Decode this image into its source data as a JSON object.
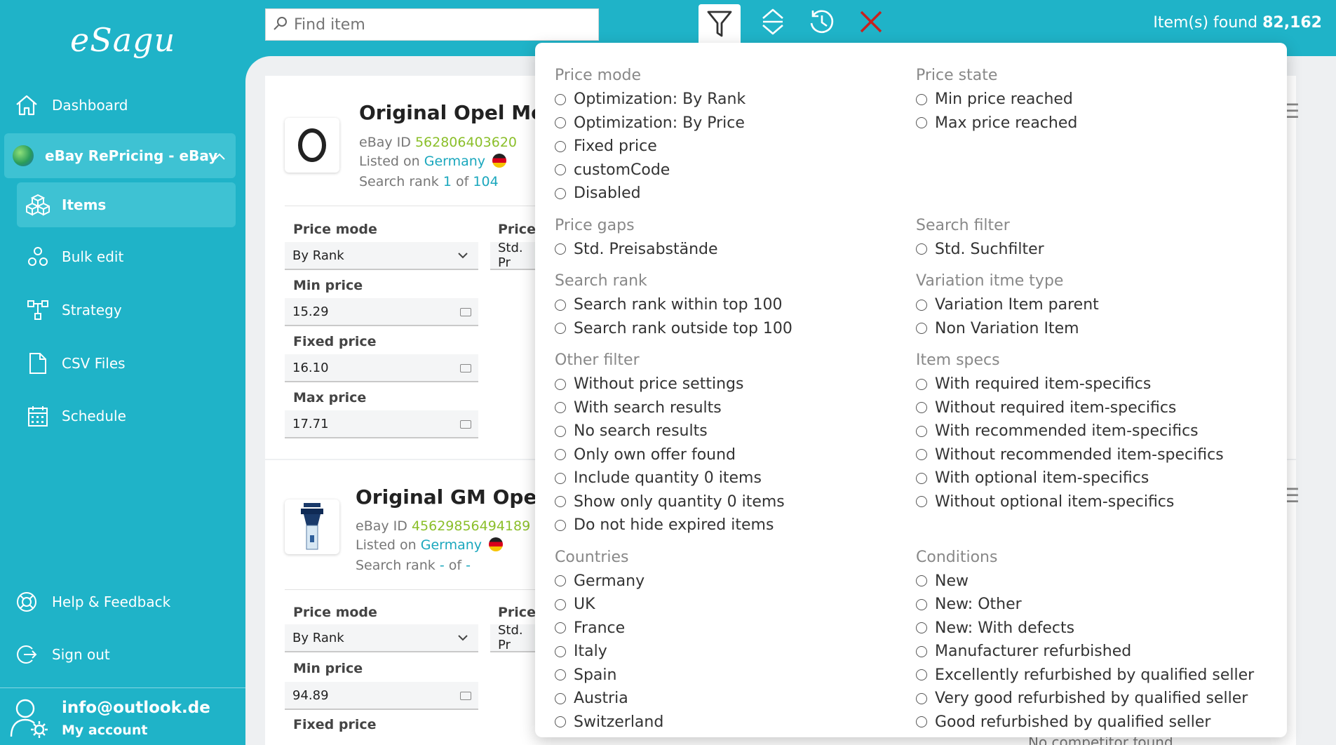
{
  "sidebar": {
    "logo": "eSagu",
    "dashboard": "Dashboard",
    "group_label": "eBay RePricing - eBay",
    "items": [
      {
        "label": "Items",
        "icon": "cubes-icon"
      },
      {
        "label": "Bulk edit",
        "icon": "bulk-edit-icon"
      },
      {
        "label": "Strategy",
        "icon": "strategy-icon"
      },
      {
        "label": "CSV Files",
        "icon": "file-icon"
      },
      {
        "label": "Schedule",
        "icon": "calendar-icon"
      }
    ],
    "help": "Help & Feedback",
    "signout": "Sign out",
    "account_email": "info@outlook.de",
    "account_label": "My account"
  },
  "topbar": {
    "search_placeholder": "Find item",
    "found_label": "Item(s) found",
    "found_count": "82,162"
  },
  "cards": [
    {
      "title": "Original Opel  Mokka",
      "ebay_id_label": "eBay ID",
      "ebay_id": "562806403620",
      "listed_label": "Listed on",
      "country": "Germany",
      "rank_label": "Search rank",
      "rank": "1",
      "of_label": "of",
      "rank_total": "104",
      "price_mode_label": "Price mode",
      "price_mode": "By Rank",
      "price_gaps_label": "Price g",
      "price_gaps": "Std. Pr",
      "min_price_label": "Min price",
      "min_price": "15.29",
      "fixed_price_label": "Fixed price",
      "fixed_price": "16.10",
      "max_price_label": "Max price",
      "max_price": "17.71"
    },
    {
      "title": "Original GM Opel Kad",
      "ebay_id_label": "eBay ID",
      "ebay_id": "45629856494189",
      "listed_label": "Listed on",
      "country": "Germany",
      "rank_label": "Search rank",
      "rank": "-",
      "of_label": "of",
      "rank_total": "-",
      "price_mode_label": "Price mode",
      "price_mode": "By Rank",
      "price_gaps_label": "Price g",
      "price_gaps": "Std. Pr",
      "min_price_label": "Min price",
      "min_price": "94.89",
      "fixed_price_label": "Fixed price",
      "no_competitor": "No competitor found"
    }
  ],
  "filter": {
    "left": [
      {
        "title": "Price mode",
        "options": [
          "Optimization: By Rank",
          "Optimization: By Price",
          "Fixed price",
          "customCode",
          "Disabled"
        ]
      },
      {
        "title": "Price gaps",
        "options": [
          "Std. Preisabstände"
        ]
      },
      {
        "title": "Search rank",
        "options": [
          "Search rank within top 100",
          "Search rank outside top 100"
        ]
      },
      {
        "title": "Other filter",
        "options": [
          "Without price settings",
          "With search results",
          "No search results",
          "Only own offer found",
          "Include quantity 0 items",
          "Show only quantity 0 items",
          "Do not hide expired items"
        ]
      },
      {
        "title": "Countries",
        "options": [
          "Germany",
          "UK",
          "France",
          "Italy",
          "Spain",
          "Austria",
          "Switzerland"
        ]
      }
    ],
    "right": [
      {
        "title": "Price state",
        "options": [
          "Min price reached",
          "Max price reached"
        ],
        "pad_rows": 3
      },
      {
        "title": "Search filter",
        "options": [
          "Std. Suchfilter"
        ]
      },
      {
        "title": "Variation itme type",
        "options": [
          "Variation Item parent",
          "Non Variation Item"
        ]
      },
      {
        "title": "Item specs",
        "options": [
          "With required item-specifics",
          "Without required item-specifics",
          "With recommended item-specifics",
          "Without recommended item-specifics",
          "With optional item-specifics",
          "Without optional item-specifics"
        ],
        "pad_rows": 1
      },
      {
        "title": "Conditions",
        "options": [
          "New",
          "New: Other",
          "New: With defects",
          "Manufacturer refurbished",
          "Excellently refurbished by qualified seller",
          "Very good refurbished by qualified seller",
          "Good refurbished by qualified seller"
        ]
      }
    ]
  }
}
